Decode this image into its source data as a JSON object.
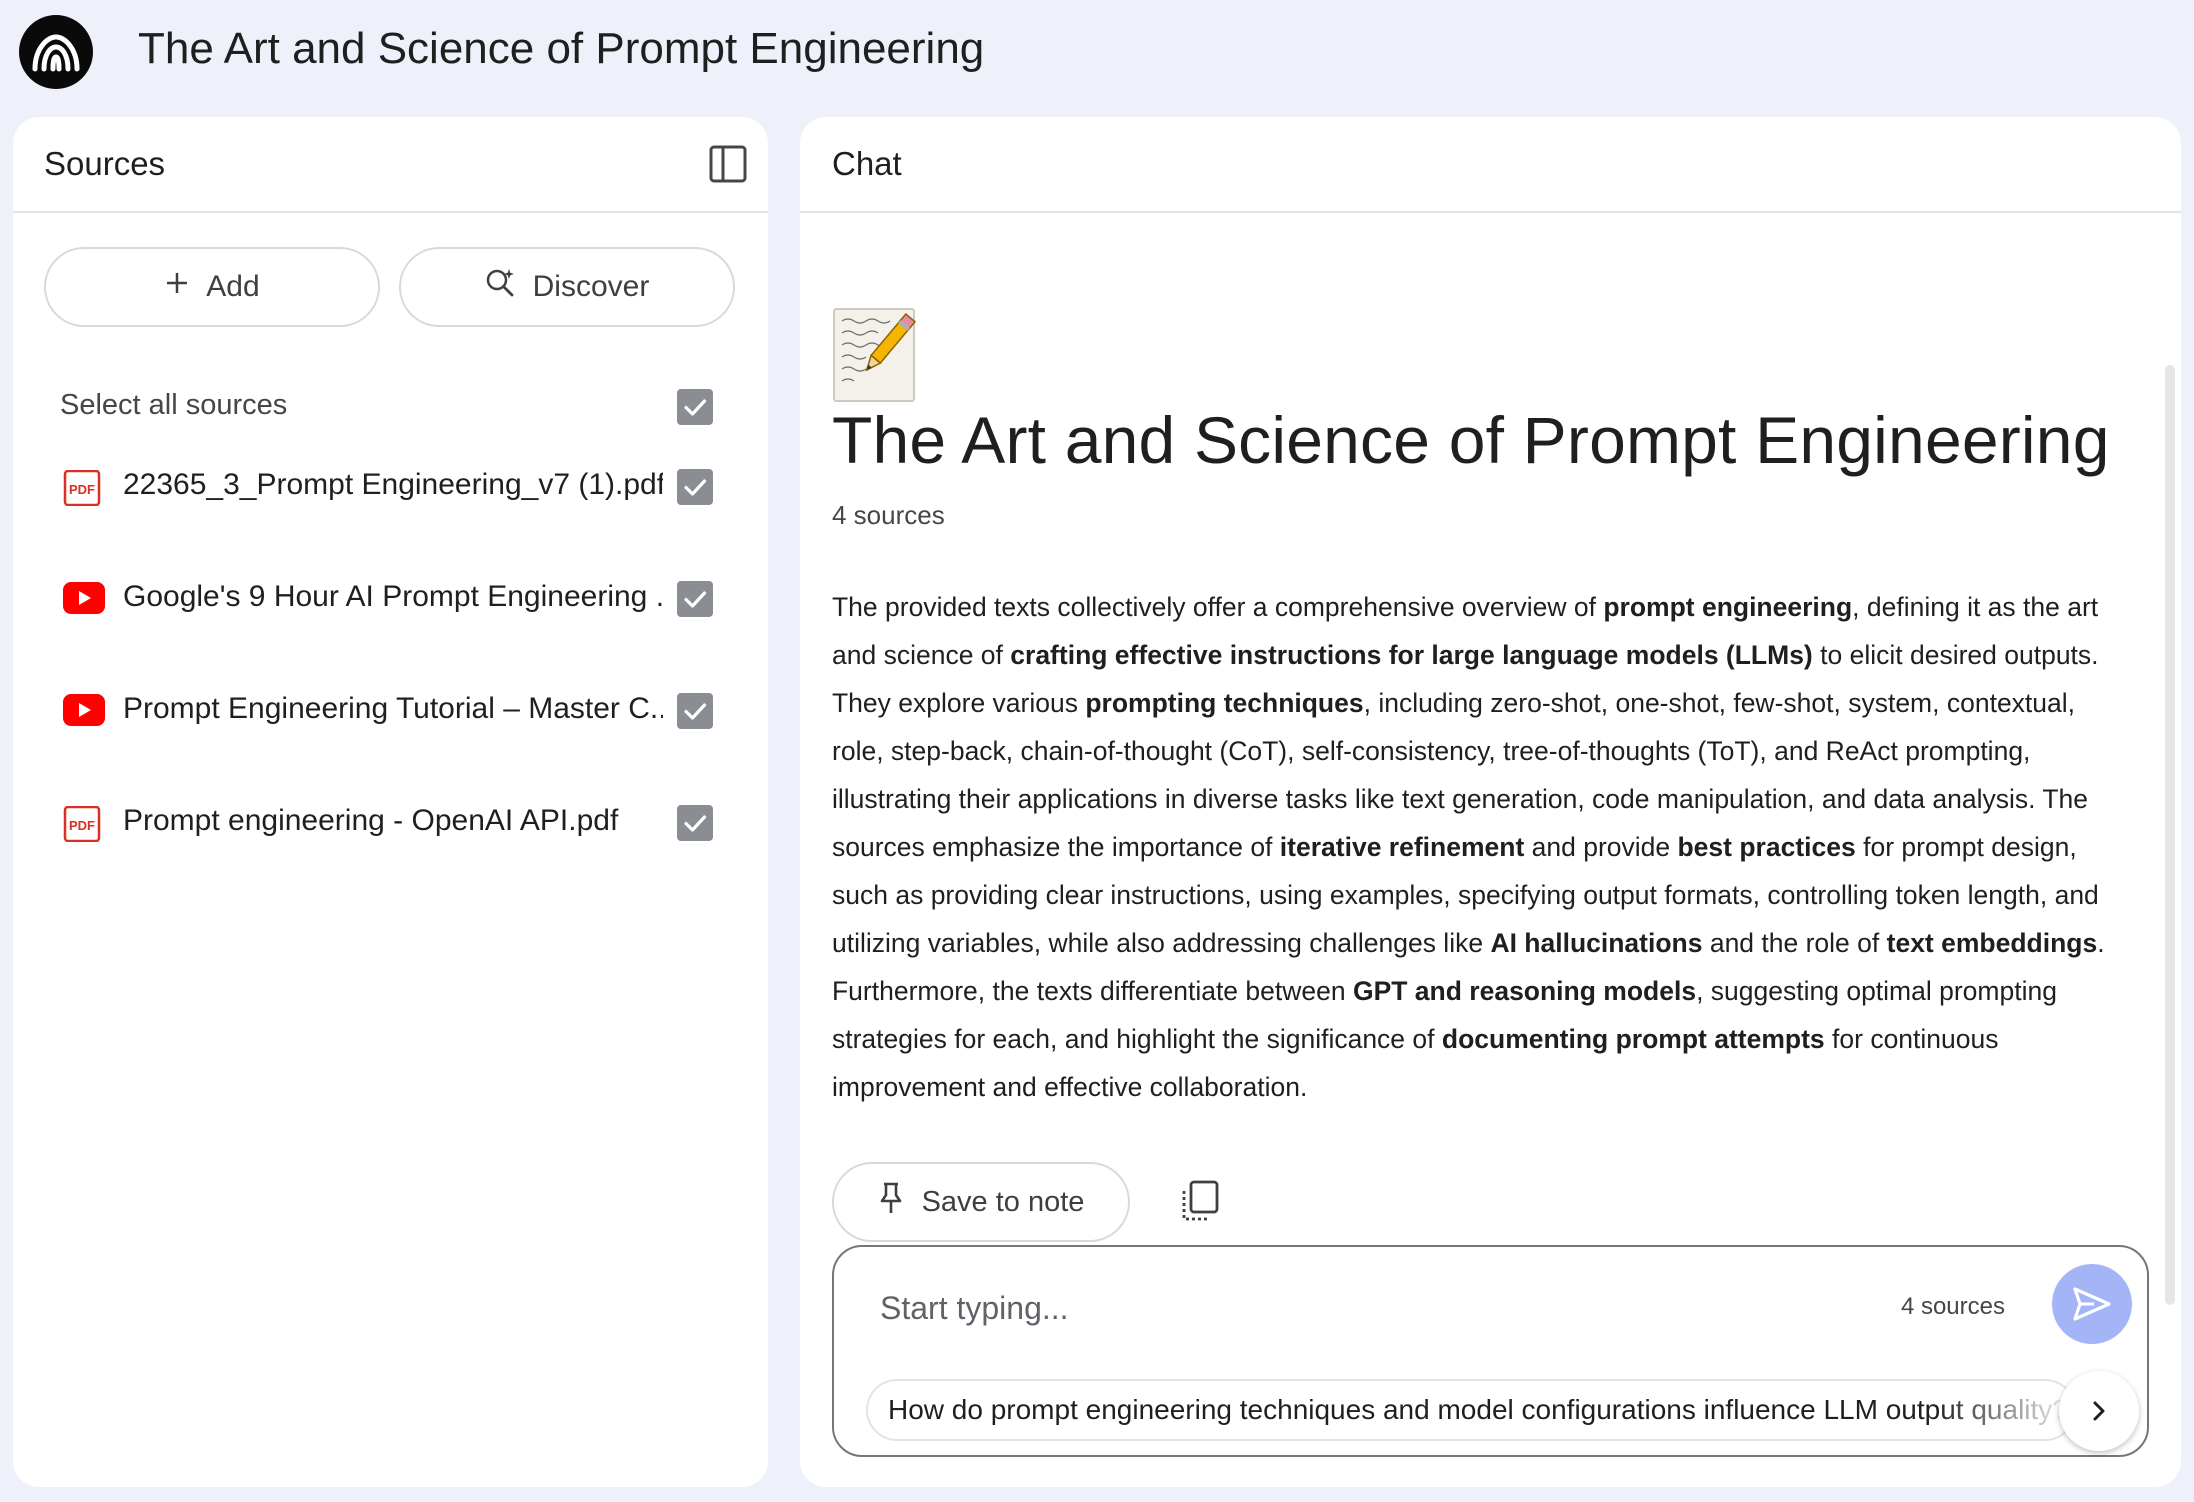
{
  "app": {
    "title": "The Art and Science of Prompt Engineering",
    "logo_icon": "notebooklm-logo-icon"
  },
  "sources_panel": {
    "title": "Sources",
    "collapse_icon": "panel-collapse-icon",
    "add_label": "Add",
    "discover_label": "Discover",
    "select_all_label": "Select all sources",
    "select_all_checked": true,
    "items": [
      {
        "label": "22365_3_Prompt Engineering_v7 (1).pdf",
        "type": "pdf",
        "icon": "pdf-icon",
        "checked": true
      },
      {
        "label": "Google's 9 Hour AI Prompt Engineering ...",
        "type": "youtube",
        "icon": "youtube-icon",
        "checked": true
      },
      {
        "label": "Prompt Engineering Tutorial – Master C...",
        "type": "youtube",
        "icon": "youtube-icon",
        "checked": true
      },
      {
        "label": "Prompt engineering - OpenAI API.pdf",
        "type": "pdf",
        "icon": "pdf-icon",
        "checked": true
      }
    ]
  },
  "chat_panel": {
    "title": "Chat",
    "notebook_emoji": "📝",
    "notebook_title": "The Art and Science of Prompt Engineering",
    "source_count": "4 sources",
    "summary": [
      {
        "t": "The provided texts collectively offer a comprehensive overview of "
      },
      {
        "t": "prompt engineering",
        "b": true
      },
      {
        "t": ", defining it as the art and science of "
      },
      {
        "t": "crafting effective instructions for large language models (LLMs)",
        "b": true
      },
      {
        "t": " to elicit desired outputs. They explore various "
      },
      {
        "t": "prompting techniques",
        "b": true
      },
      {
        "t": ", including zero-shot, one-shot, few-shot, system, contextual, role, step-back, chain-of-thought (CoT), self-consistency, tree-of-thoughts (ToT), and ReAct prompting, illustrating their applications in diverse tasks like text generation, code manipulation, and data analysis. The sources emphasize the importance of "
      },
      {
        "t": "iterative refinement",
        "b": true
      },
      {
        "t": " and provide "
      },
      {
        "t": "best practices",
        "b": true
      },
      {
        "t": " for prompt design, such as providing clear instructions, using examples, specifying output formats, controlling token length, and utilizing variables, while also addressing challenges like "
      },
      {
        "t": "AI hallucinations",
        "b": true
      },
      {
        "t": " and the role of "
      },
      {
        "t": "text embeddings",
        "b": true
      },
      {
        "t": ". Furthermore, the texts differentiate between "
      },
      {
        "t": "GPT and reasoning models",
        "b": true
      },
      {
        "t": ", suggesting optimal prompting strategies for each, and highlight the significance of "
      },
      {
        "t": "documenting prompt attempts",
        "b": true
      },
      {
        "t": " for continuous improvement and effective collaboration."
      }
    ],
    "save_note_label": "Save to note",
    "pin_icon": "pin-icon",
    "copy_icon": "copy-icon",
    "composer": {
      "placeholder": "Start typing...",
      "value": "",
      "sources_label": "4 sources",
      "send_icon": "send-icon",
      "suggestion": "How do prompt engineering techniques and model configurations influence LLM output quality?",
      "next_icon": "chevron-right-icon"
    }
  },
  "colors": {
    "page_bg": "#eef1fa",
    "panel_bg": "#ffffff",
    "checkbox": "#8a8d91",
    "pdf_red": "#d93025",
    "youtube_red": "#ff0000",
    "send_button": "#a3b4f7"
  }
}
